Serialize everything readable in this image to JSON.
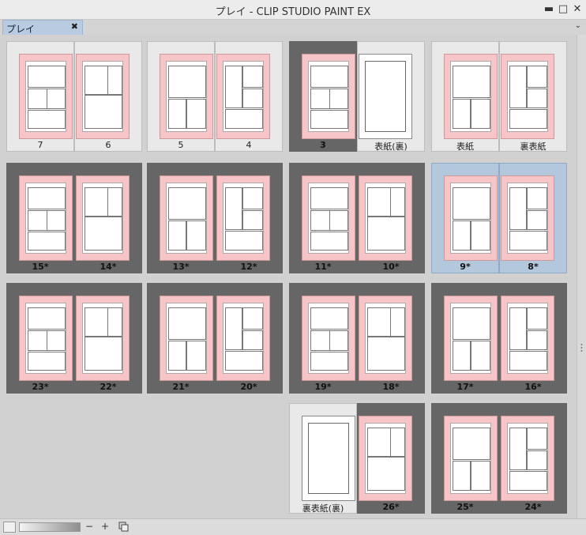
{
  "window": {
    "title": "プレイ - CLIP STUDIO PAINT EX"
  },
  "tab": {
    "label": "プレイ"
  },
  "controls": {
    "minus": "−",
    "plus": "+"
  },
  "spreads": [
    {
      "left": "7",
      "right": "6",
      "style": "light"
    },
    {
      "left": "5",
      "right": "4",
      "style": "light"
    },
    {
      "left": "3",
      "right": "表紙(裏)",
      "style": "mixed"
    },
    {
      "left": "表紙",
      "right": "裏表紙",
      "style": "light"
    },
    {
      "left": "15*",
      "right": "14*",
      "style": "dark"
    },
    {
      "left": "13*",
      "right": "12*",
      "style": "dark"
    },
    {
      "left": "11*",
      "right": "10*",
      "style": "dark"
    },
    {
      "left": "9*",
      "right": "8*",
      "style": "sel"
    },
    {
      "left": "23*",
      "right": "22*",
      "style": "dark"
    },
    {
      "left": "21*",
      "right": "20*",
      "style": "dark"
    },
    {
      "left": "19*",
      "right": "18*",
      "style": "dark"
    },
    {
      "left": "17*",
      "right": "16*",
      "style": "dark"
    },
    {
      "left": "裏表紙(裏)",
      "right": "26*",
      "style": "mixed2"
    },
    {
      "left": "25*",
      "right": "24*",
      "style": "dark"
    }
  ]
}
